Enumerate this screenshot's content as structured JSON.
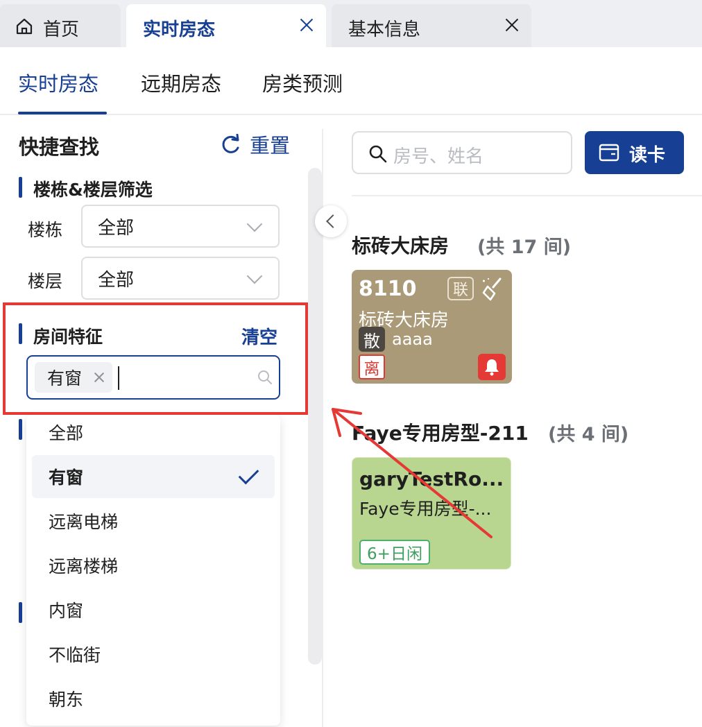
{
  "top_tabs": [
    {
      "label": "首页",
      "icon": "home-icon",
      "active": false
    },
    {
      "label": "实时房态",
      "active": true
    },
    {
      "label": "基本信息",
      "active": false
    }
  ],
  "sub_tabs": [
    "实时房态",
    "远期房态",
    "房类预测"
  ],
  "sidebar": {
    "title": "快捷查找",
    "reset_label": "重置",
    "building_floor": {
      "title": "楼栋&楼层筛选",
      "building_label": "楼栋",
      "building_value": "全部",
      "floor_label": "楼层",
      "floor_value": "全部"
    },
    "features": {
      "title": "房间特征",
      "clear_label": "清空",
      "selected_chip": "有窗",
      "options": [
        "全部",
        "有窗",
        "远离电梯",
        "远离楼梯",
        "内窗",
        "不临街",
        "朝东"
      ],
      "selected_option": "有窗"
    }
  },
  "search": {
    "placeholder": "房号、姓名"
  },
  "read_card_label": "读卡",
  "room_types": [
    {
      "title": "标砖大床房",
      "count": "(共 17 间)",
      "rooms": [
        {
          "number": "8110",
          "type": "标砖大床房",
          "badge_linked": "联",
          "badge_scatter": "散",
          "guest": "aaaa",
          "badge_leave": "离",
          "color": "#ab9a78"
        }
      ]
    },
    {
      "title": "Faye专用房型-211",
      "count": "(共 4 间)",
      "rooms": [
        {
          "number": "garyTestRo...",
          "type": "Faye专用房型-...",
          "idle_tag": "6+日闲",
          "color": "#b9d690"
        }
      ]
    }
  ],
  "colors": {
    "primary": "#173f94",
    "highlight": "#e53935"
  }
}
